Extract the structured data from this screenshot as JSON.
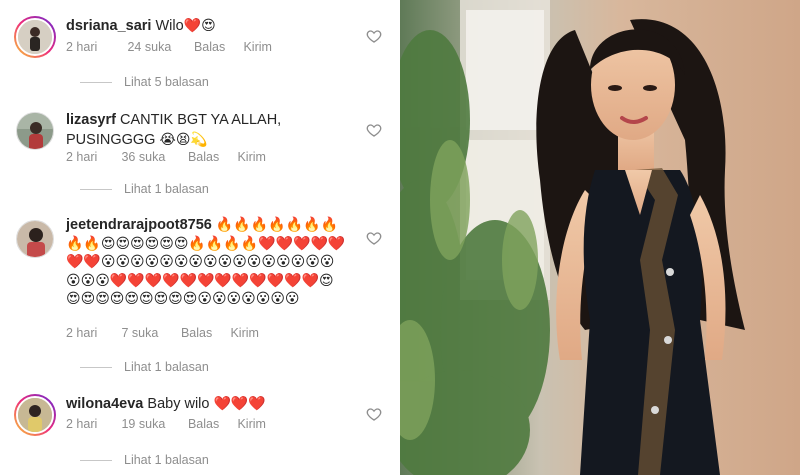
{
  "comments": [
    {
      "username": "dsriana_sari",
      "text": "Wilo",
      "emoji": "❤️😍",
      "time": "2 hari",
      "likes": "24 suka",
      "reply": "Balas",
      "send": "Kirim",
      "replies": "Lihat 5 balasan"
    },
    {
      "username": "lizasyrf",
      "text": "CANTIK BGT YA ALLAH, PUSINGGGG",
      "emoji": "😭😫💫",
      "time": "2 hari",
      "likes": "36 suka",
      "reply": "Balas",
      "send": "Kirim",
      "replies": "Lihat 1 balasan"
    },
    {
      "username": "jeetendrarajpoot8756",
      "text": "",
      "emoji": "🔥🔥🔥🔥🔥🔥🔥🔥🔥😍😍😍😍😍😍🔥🔥🔥🔥❤️❤️❤️❤️❤️❤️❤️😮😮😮😮😮😮😮😮😮😮😮😮😮😮😮😮😮😮😮❤️❤️❤️❤️❤️❤️❤️❤️❤️❤️❤️❤️😍😍😍😍😍😍😍😍😍😍😮😮😮😮😮😮😮",
      "time": "2 hari",
      "likes": "7 suka",
      "reply": "Balas",
      "send": "Kirim",
      "replies": "Lihat 1 balasan"
    },
    {
      "username": "wilona4eva",
      "text": "Baby wilo",
      "emoji": "❤️❤️❤️",
      "time": "2 hari",
      "likes": "19 suka",
      "reply": "Balas",
      "send": "Kirim",
      "replies": "Lihat 1 balasan"
    }
  ],
  "colors": {
    "text": "#262626",
    "meta": "#8e8e8e",
    "heart_stroke": "#8e8e8e",
    "story_ring_start": "#f9ce34",
    "story_ring_mid": "#ee2a7b",
    "story_ring_end": "#6228d7"
  },
  "icons": {
    "like": "heart-outline-icon"
  }
}
